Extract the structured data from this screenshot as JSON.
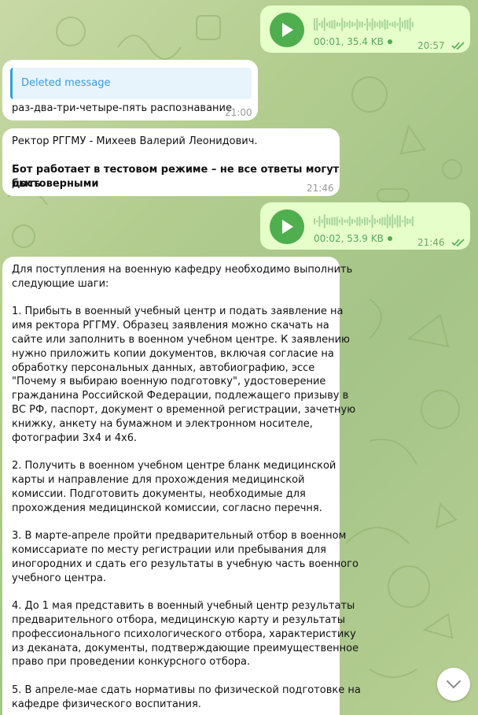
{
  "messages": [
    {
      "id": "voice1",
      "type": "voice",
      "direction": "outgoing",
      "meta": "00:01, 35.4 KB",
      "time": "20:57"
    },
    {
      "id": "reply",
      "type": "text",
      "direction": "incoming",
      "quote": "Deleted message",
      "text": "раз-два-три-четыре-пять распознавание",
      "time": "21:00"
    },
    {
      "id": "rector",
      "type": "text",
      "direction": "incoming",
      "line1": "Ректор РГГМУ - Михеев Валерий Леонидович.",
      "bold_line1": "Бот работает в тестовом режиме – не все ответы могут быть",
      "bold_line2": "достоверными",
      "time": "21:46"
    },
    {
      "id": "voice2",
      "type": "voice",
      "direction": "outgoing",
      "meta": "00:02, 53.9 KB",
      "time": "21:46"
    },
    {
      "id": "long",
      "type": "text",
      "direction": "incoming",
      "lines": [
        "Для поступления на военную кафедру необходимо выполнить",
        "следующие шаги:",
        "",
        "1. Прибыть в военный учебный центр и подать заявление на",
        "имя ректора РГГМУ. Образец заявления можно скачать на",
        "сайте или заполнить в военном учебном центре. К заявлению",
        "нужно приложить копии документов, включая согласие на",
        "обработку персональных данных, автобиографию, эссе",
        "\"Почему я выбираю военную подготовку\", удостоверение",
        "гражданина Российской Федерации, подлежащего призыву в",
        "ВС РФ, паспорт, документ о временной регистрации, зачетную",
        "книжку, анкету на бумажном и электронном носителе,",
        "фотографии 3х4 и 4х6.",
        "",
        "2. Получить в военном учебном центре бланк медицинской",
        "карты и направление для прохождения медицинской",
        "комиссии. Подготовить документы, необходимые для",
        "прохождения медицинской комиссии, согласно перечня.",
        "",
        "3. В марте-апреле пройти предварительный отбор в военном",
        "комиссариате по месту регистрации или пребывания для",
        "иногородних и сдать его результаты в учебную часть военного",
        "учебного центра.",
        "",
        "4. До 1 мая представить в военный учебный центр результаты",
        "предварительного отбора, медицинскую карту и результаты",
        "профессионального психологического отбора, характеристику",
        "из деканата, документы, подтверждающие преимущественное",
        "право при проведении конкурсного отбора.",
        "",
        "5. В апреле-мае сдать нормативы по физической подготовке на",
        "кафедре физического воспитания."
      ]
    }
  ],
  "icons": {
    "play": "play-icon",
    "read": "double-check-icon",
    "scroll_down": "chevron-down-icon"
  },
  "colors": {
    "outgoing_bubble": "#e6ffca",
    "incoming_bubble": "#ffffff",
    "play_button": "#4fae4e",
    "link_blue": "#3a9bd9"
  }
}
